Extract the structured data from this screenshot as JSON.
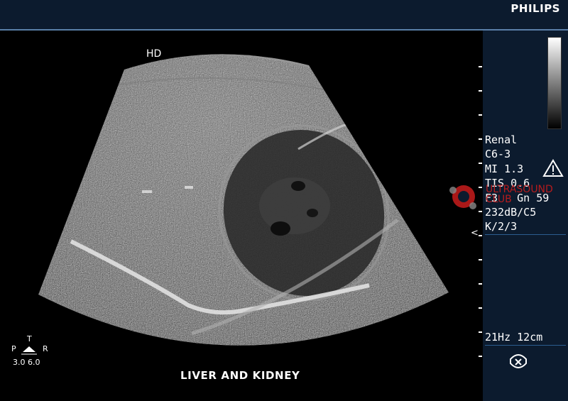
{
  "header": {
    "brand": "PHILIPS"
  },
  "image": {
    "mode_label": "HD",
    "caption": "LIVER AND KIDNEY",
    "focus_marker": "<"
  },
  "orientation": {
    "top": "T",
    "left": "P",
    "right": "R",
    "values": "3.0 6.0"
  },
  "parameters": {
    "preset": "Renal",
    "probe": "C6-3",
    "mi": "MI 1.3",
    "tis": "TIS 0.6",
    "gain_line": "F3   Gn 59",
    "dynamic_range": "232dB/C5",
    "processing": "K/2/3",
    "frame_rate_depth": "21Hz  12cm"
  },
  "watermark": {
    "line1": "ULTRASOUND",
    "line2": "CLUB"
  },
  "colors": {
    "panel": "#0c1b2e",
    "separator": "#2c5d8f",
    "watermark": "#c81c1c"
  },
  "icons": [
    "warning-icon",
    "probe-icon",
    "depth-scale",
    "grayscale-bar"
  ]
}
